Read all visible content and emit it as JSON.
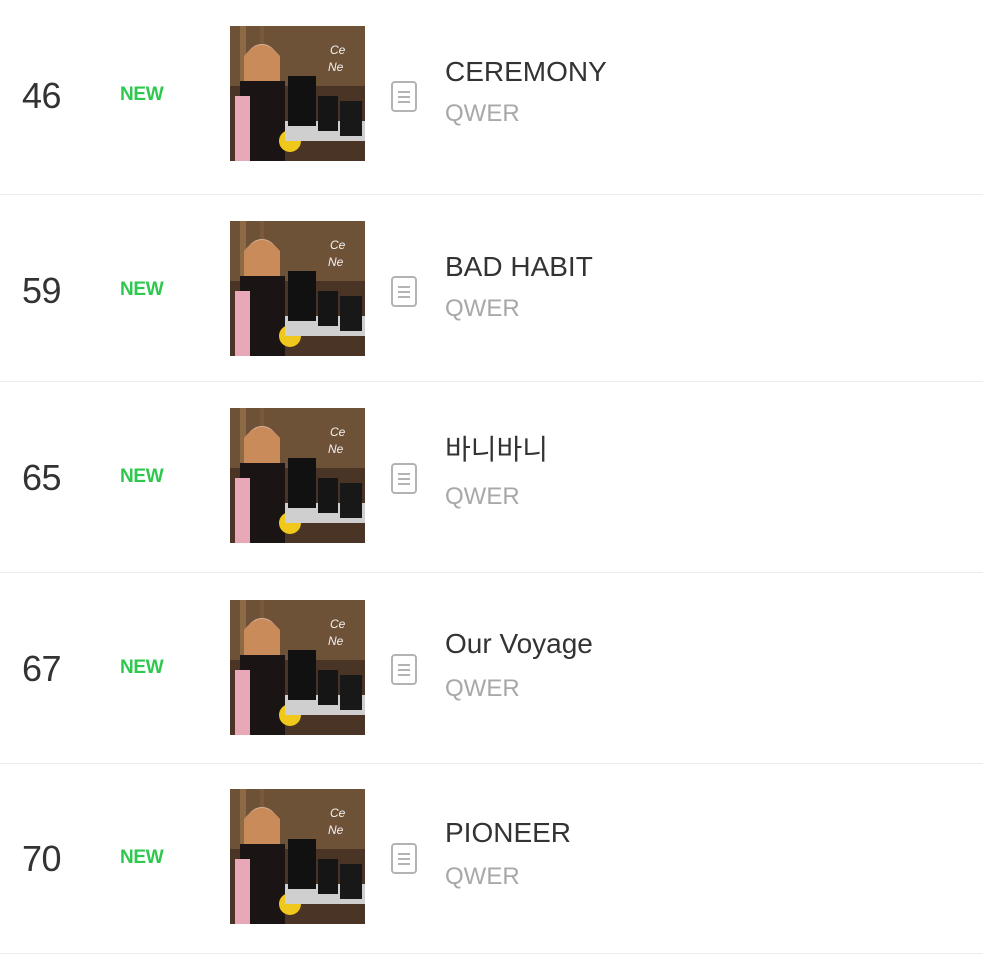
{
  "chart": {
    "rows": [
      {
        "rank": "46",
        "badge": "NEW",
        "title": "CEREMONY",
        "artist": "QWER"
      },
      {
        "rank": "59",
        "badge": "NEW",
        "title": "BAD HABIT",
        "artist": "QWER"
      },
      {
        "rank": "65",
        "badge": "NEW",
        "title": "바니바니",
        "artist": "QWER"
      },
      {
        "rank": "67",
        "badge": "NEW",
        "title": "Our Voyage",
        "artist": "QWER"
      },
      {
        "rank": "70",
        "badge": "NEW",
        "title": "PIONEER",
        "artist": "QWER"
      }
    ]
  },
  "colors": {
    "new_badge": "#2fc84f",
    "title": "#333333",
    "artist": "#a8a8a8",
    "divider": "#ececec"
  },
  "icons": {
    "info": "lyrics-info-icon",
    "cover": "album-cover"
  }
}
